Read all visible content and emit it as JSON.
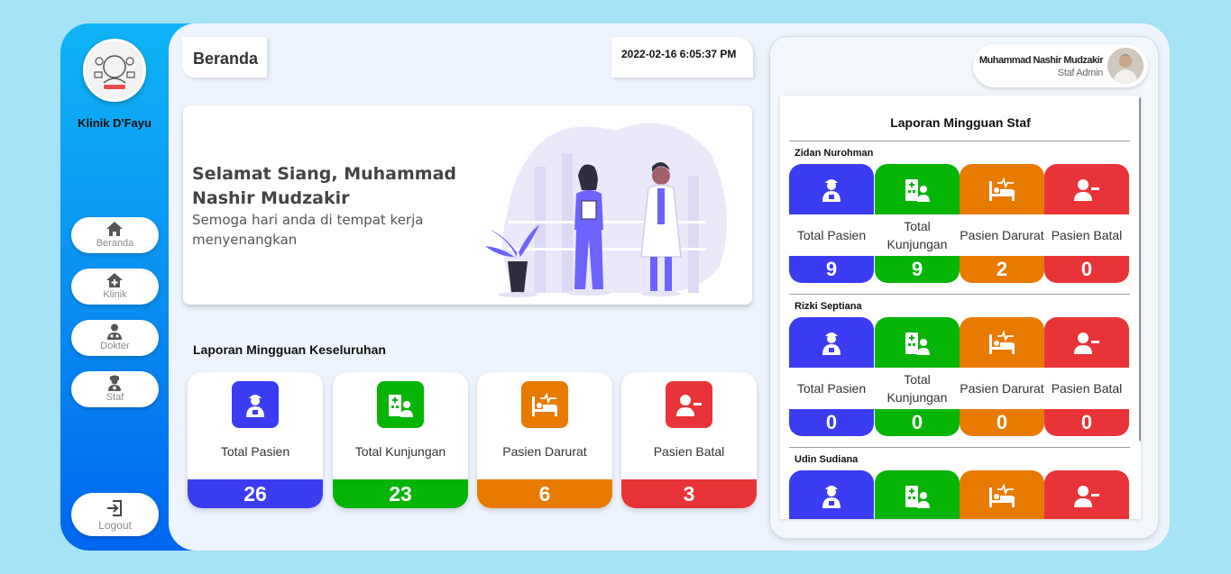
{
  "app": {
    "clinic_name": "Klinik D'Fayu"
  },
  "nav": {
    "items": [
      {
        "label": "Beranda",
        "icon": "home-icon"
      },
      {
        "label": "Klinik",
        "icon": "clinic-icon"
      },
      {
        "label": "Dokter",
        "icon": "doctor-icon"
      },
      {
        "label": "Staf",
        "icon": "nurse-icon"
      }
    ],
    "logout": {
      "label": "Logout",
      "icon": "logout-icon"
    }
  },
  "header": {
    "title": "Beranda",
    "datetime": "2022-02-16 6:05:37 PM"
  },
  "welcome": {
    "greeting": "Selamat Siang, Muhammad Nashir Mudzakir",
    "message": "Semoga hari anda di tempat kerja menyenangkan"
  },
  "overall": {
    "title": "Laporan Mingguan Keseluruhan",
    "cards": [
      {
        "label": "Total Pasien",
        "value": "26",
        "color": "#3b3cf2",
        "icon": "patient-icon"
      },
      {
        "label": "Total Kunjungan",
        "value": "23",
        "color": "#06b406",
        "icon": "hospital-visit-icon"
      },
      {
        "label": "Pasien Darurat",
        "value": "6",
        "color": "#e87a00",
        "icon": "hospital-bed-icon"
      },
      {
        "label": "Pasien Batal",
        "value": "3",
        "color": "#e83438",
        "icon": "user-minus-icon"
      }
    ]
  },
  "profile": {
    "name": "Muhammad Nashir Mudzakir",
    "role": "Staf Admin"
  },
  "staff_report": {
    "title": "Laporan Mingguan Staf",
    "labels": [
      "Total Pasien",
      "Total Kunjungan",
      "Pasien Darurat",
      "Pasien Batal"
    ],
    "staff": [
      {
        "name": "Zidan Nurohman",
        "values": [
          "9",
          "9",
          "2",
          "0"
        ]
      },
      {
        "name": "Rizki Septiana",
        "values": [
          "0",
          "0",
          "0",
          "0"
        ]
      },
      {
        "name": "Udin Sudiana",
        "values": [
          "",
          "",
          "",
          ""
        ]
      }
    ]
  },
  "colors": {
    "blue": "#3b3cf2",
    "green": "#06b406",
    "orange": "#e87a00",
    "red": "#e83438",
    "sidebar_top": "#0fb4f5",
    "sidebar_bottom": "#0066f0"
  }
}
